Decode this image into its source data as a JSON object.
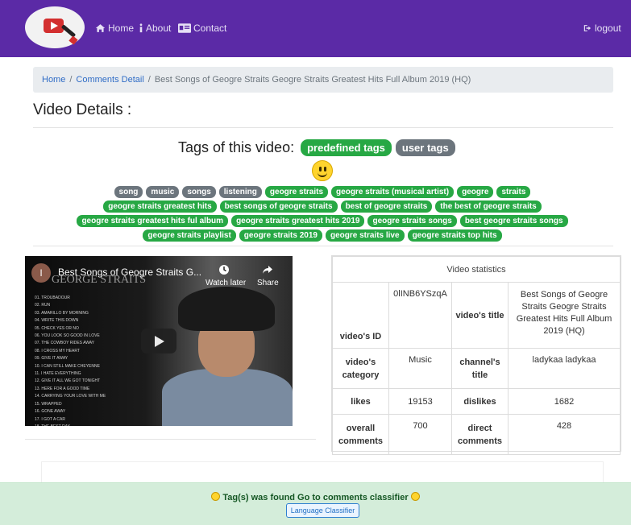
{
  "nav": {
    "home": "Home",
    "about": "About",
    "contact": "Contact",
    "logout": "logout"
  },
  "breadcrumb": {
    "items": [
      "Home",
      "Comments Detail"
    ],
    "current": "Best Songs of Geogre Straits Geogre Straits Greatest Hits Full Album 2019 (HQ)"
  },
  "page_title": "Video Details :",
  "tags": {
    "heading": "Tags of this video:",
    "predefined_label": "predefined tags",
    "user_label": "user tags",
    "emoji_icon": "smiley-icon",
    "user_tags": [
      "song",
      "music",
      "songs",
      "listening"
    ],
    "predefined_tags": [
      "geogre straits",
      "geogre straits (musical artist)",
      "geogre",
      "straits",
      "geogre straits greatest hits",
      "best songs of geogre straits",
      "best of geogre straits",
      "the best of geogre straits",
      "geogre straits greatest hits ful album",
      "geogre straits greatest hits 2019",
      "geogre straits songs",
      "best geogre straits songs",
      "geogre straits playlist",
      "geogre straits 2019",
      "geogre straits live",
      "geogre straits top hits"
    ]
  },
  "video": {
    "title": "Best Songs of Geogre Straits G...",
    "avatar_letter": "I",
    "watch_later": "Watch later",
    "share": "Share",
    "watermark": "GEORGE STRAITS",
    "tracklist": [
      "01. TROUBADOUR",
      "02. RUN",
      "03. AMARILLO BY MORNING",
      "04. WRITE THIS DOWN",
      "05. CHECK YES OR NO",
      "06. YOU LOOK SO GOOD IN LOVE",
      "07. THE COWBOY RIDES AWAY",
      "08. I CROSS MY HEART",
      "09. GIVE IT AWAY",
      "10. I CAN STILL MAKE CHEYENNE",
      "11. I HATE EVERYTHING",
      "12. GIVE IT ALL WE GOT TONIGHT",
      "13. HERE FOR A GOOD TIME",
      "14. CARRYING YOUR LOVE WITH ME",
      "15. WRAPPED",
      "16. GONE AWAY",
      "17. I GOT A CAR",
      "18. THE BEST DAY",
      "19. OCEAN FRONT PROPERTY",
      "20. BLUE CLEAR SKY"
    ]
  },
  "stats": {
    "caption": "Video statistics",
    "video_id_label": "video's ID",
    "video_id": "0lINB6YSzqA",
    "video_title_label": "video's title",
    "video_title": "Best Songs of Geogre Straits Geogre Straits Greatest Hits Full Album 2019 (HQ)",
    "category_label": "video's category",
    "category": "Music",
    "channel_label": "channel's title",
    "channel": "ladykaa ladykaa",
    "likes_label": "likes",
    "likes": "19153",
    "dislikes_label": "dislikes",
    "dislikes": "1682",
    "comments_label": "overall comments",
    "comments": "700",
    "direct_label": "direct comments",
    "direct": "428"
  },
  "footer": {
    "message": "Tag(s) was found Go to comments classifier",
    "button": "Language Classifier"
  }
}
